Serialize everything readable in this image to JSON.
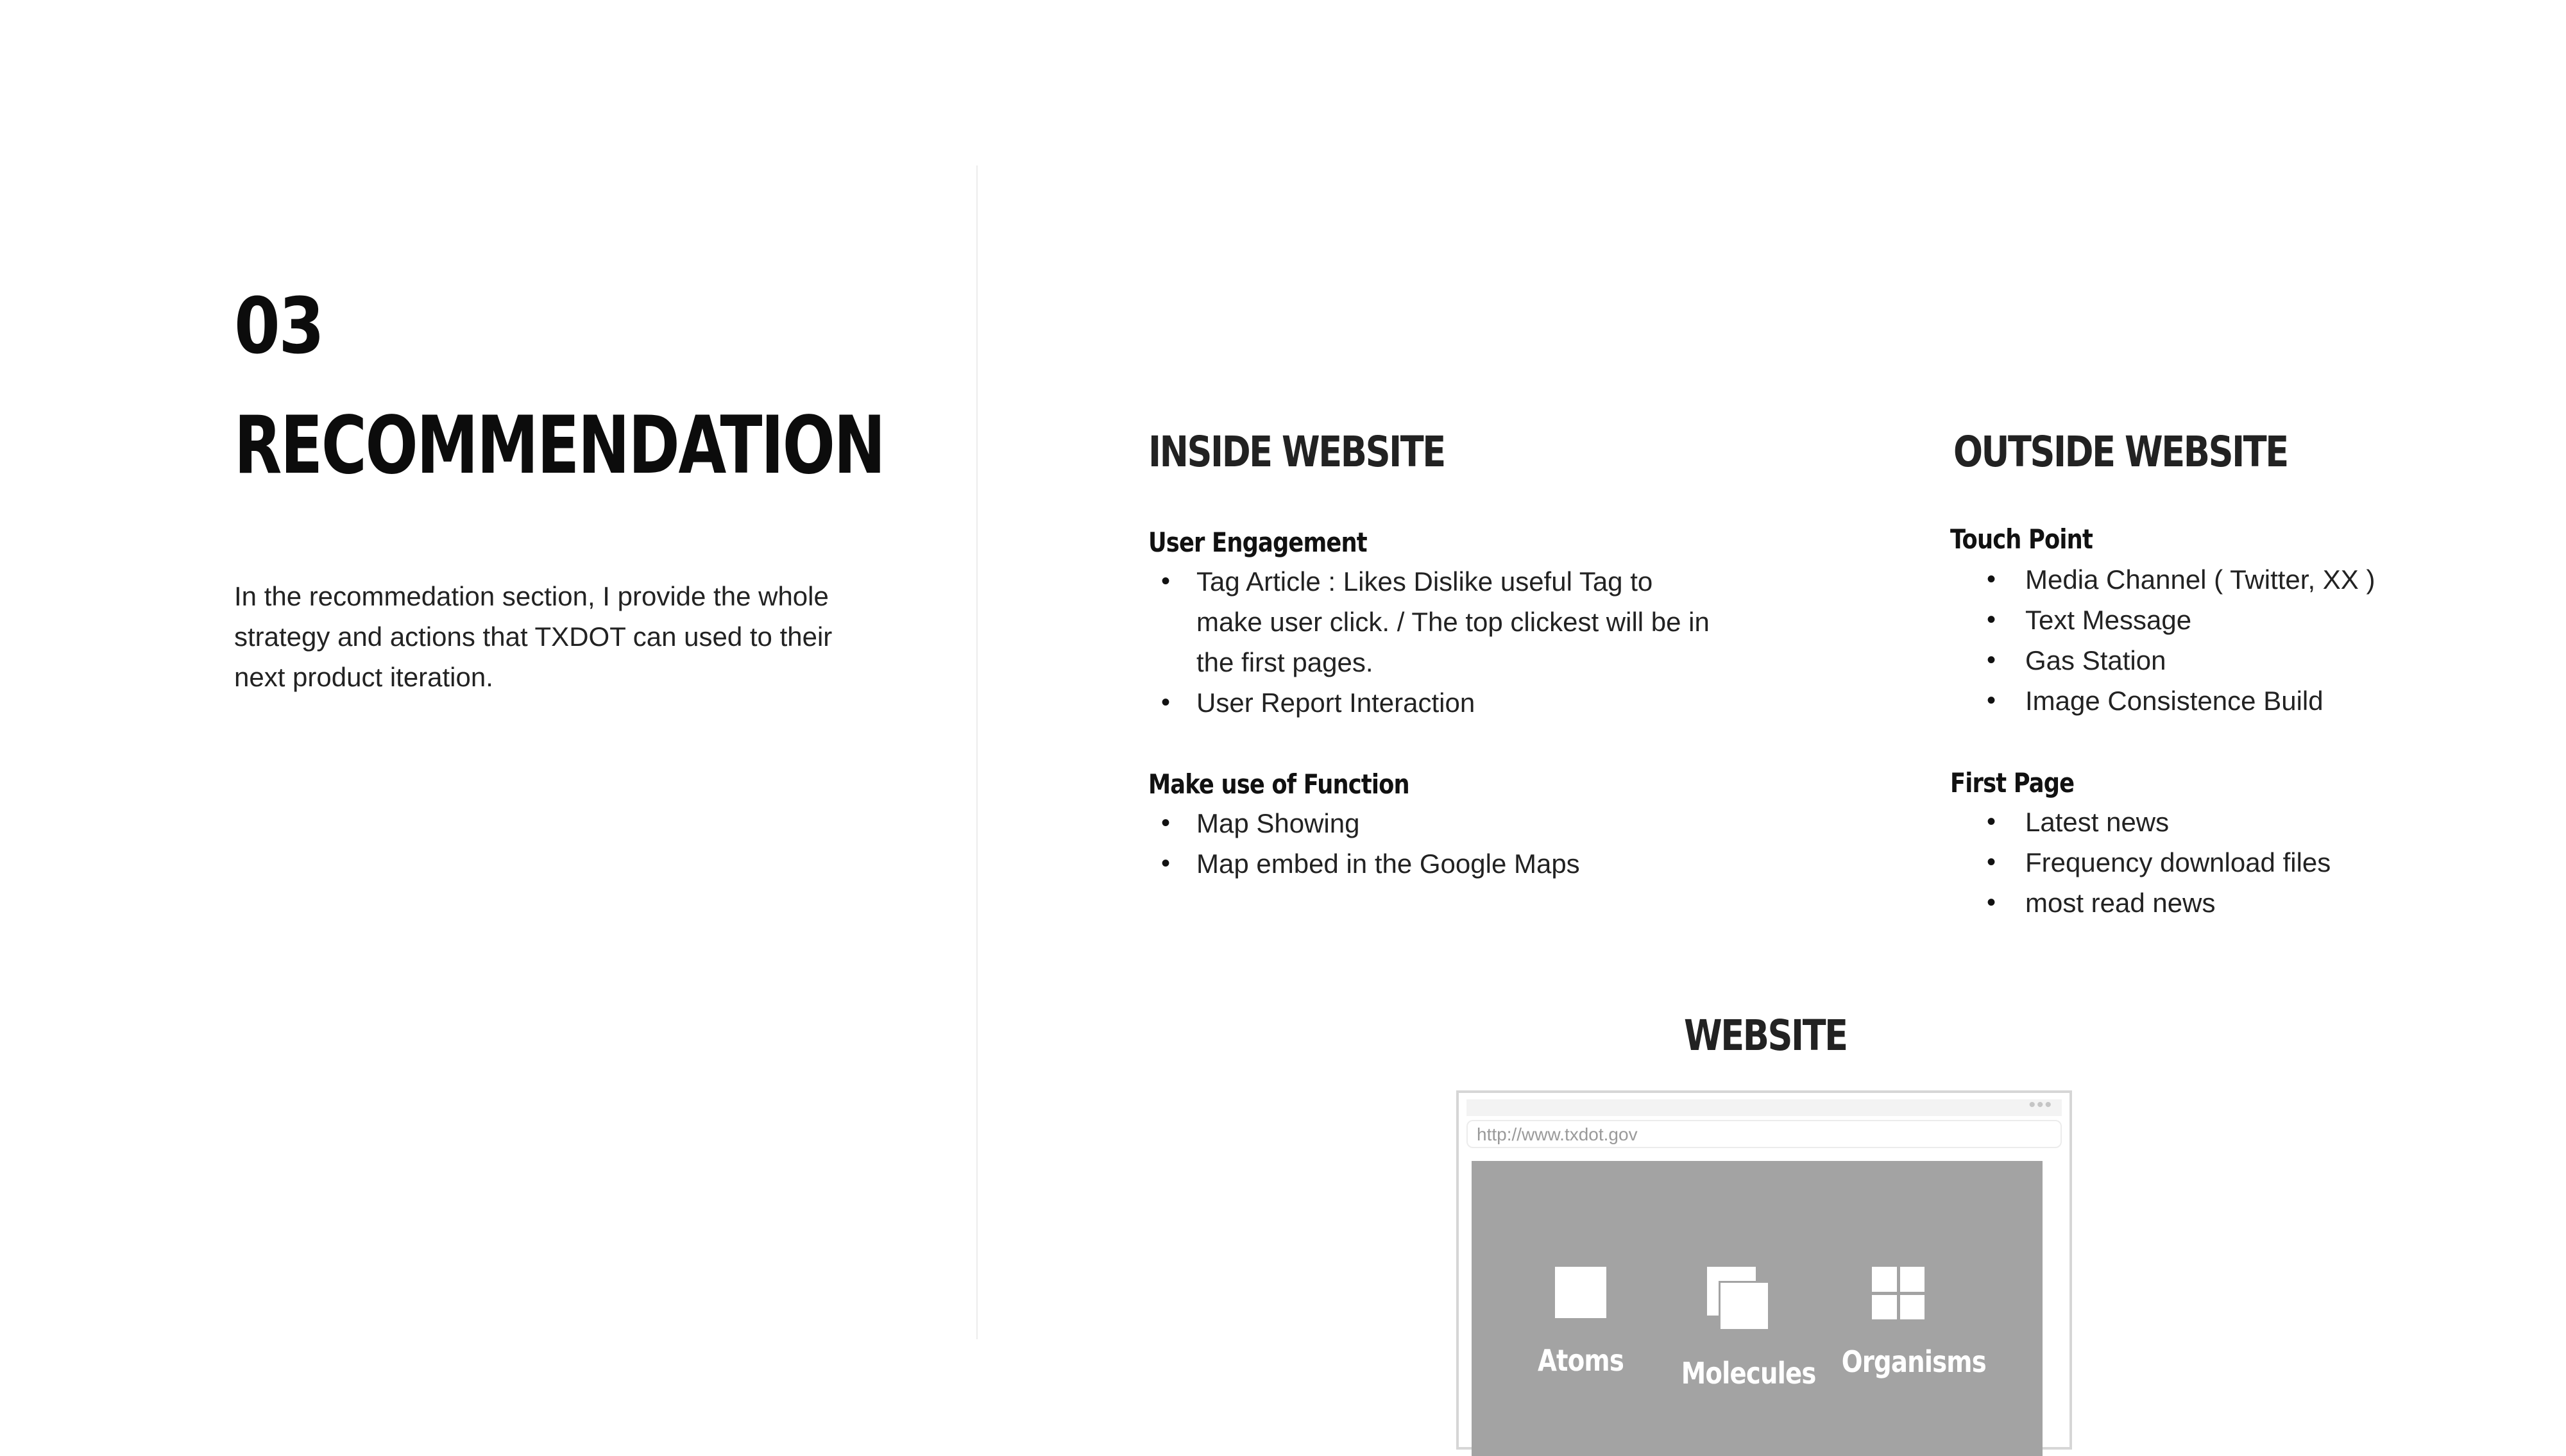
{
  "left": {
    "section_number": "03",
    "section_title": "RECOMMENDATION",
    "intro_lines": [
      "In the recommedation section, I provide the whole",
      "strategy and actions that TXDOT can used to their",
      "next product iteration."
    ]
  },
  "inside": {
    "heading": "INSIDE WEBSITE",
    "groups": [
      {
        "title": "User Engagement",
        "items": [
          "Tag Article : Likes Dislike useful Tag to make user click. / The top clickest will be in the first pages.",
          "User Report Interaction"
        ]
      },
      {
        "title": "Make use of Function",
        "items": [
          "Map Showing",
          "Map embed in the Google Maps"
        ]
      }
    ]
  },
  "outside": {
    "heading": "OUTSIDE WEBSITE",
    "groups": [
      {
        "title": "Touch Point",
        "items": [
          "Media Channel ( Twitter, XX )",
          "Text Message",
          "Gas Station",
          "Image Consistence Build"
        ]
      },
      {
        "title": "First Page",
        "items": [
          "Latest news",
          "Frequency download files",
          "most read news"
        ]
      }
    ]
  },
  "website": {
    "heading": "WEBSITE",
    "url": "http://www.txdot.gov",
    "components": [
      {
        "label": "Atoms",
        "icon": "single-square-icon"
      },
      {
        "label": "Molecules",
        "icon": "stacked-squares-icon"
      },
      {
        "label": "Organisms",
        "icon": "grid-squares-icon"
      }
    ]
  },
  "colors": {
    "text": "#111111",
    "mock_content": "#a3a3a3",
    "divider": "#ececec"
  }
}
